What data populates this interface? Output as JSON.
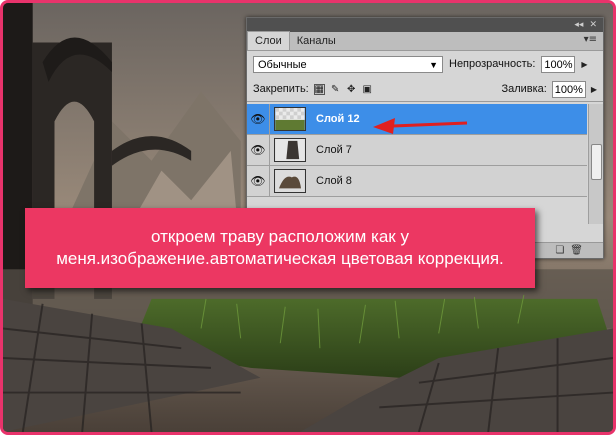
{
  "panel": {
    "topbar_glyphs": [
      "◂◂",
      "✕"
    ],
    "tabs": [
      {
        "label": "Слои",
        "active": true
      },
      {
        "label": "Каналы",
        "active": false
      }
    ],
    "tab_menu_icon": "panel-menu-icon",
    "blend_mode": "Обычные",
    "opacity_label": "Непрозрачность:",
    "opacity_value": "100%",
    "lock_label": "Закрепить:",
    "fill_label": "Заливка:",
    "fill_value": "100%",
    "layers": [
      {
        "name": "Слой 12",
        "selected": true
      },
      {
        "name": "Слой 7",
        "selected": false
      },
      {
        "name": "Слой 8",
        "selected": false
      }
    ]
  },
  "caption": {
    "text": "откроем траву расположим как у меня.изображение.автоматическая цветовая коррекция."
  },
  "colors": {
    "accent": "#e8336b",
    "selection": "#3d8ee8",
    "arrow": "#e02020"
  }
}
